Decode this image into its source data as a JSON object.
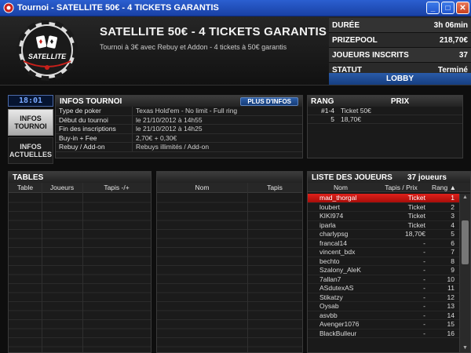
{
  "window": {
    "title": "Tournoi - SATELLITE 50€ - 4 TICKETS GARANTIS"
  },
  "logo": {
    "text": "SATELLITE"
  },
  "header": {
    "title": "SATELLITE 50€ - 4 TICKETS GARANTIS",
    "subtitle": "Tournoi à 3€ avec Rebuy et Addon - 4 tickets à 50€ garantis",
    "stats": [
      {
        "label": "DURÉE",
        "value": "3h 06min"
      },
      {
        "label": "PRIZEPOOL",
        "value": "218,70€"
      },
      {
        "label": "JOUEURS INSCRITS",
        "value": "37"
      },
      {
        "label": "STATUT",
        "value": "Terminé"
      }
    ],
    "lobby_label": "LOBBY"
  },
  "clock": "18:01",
  "tabs": {
    "infos_tournoi": "INFOS TOURNOI",
    "infos_actuelles": "INFOS ACTUELLES"
  },
  "infos": {
    "title": "INFOS TOURNOI",
    "more_button": "PLUS D'INFOS",
    "rows": [
      {
        "k": "Type de poker",
        "v": "Texas Hold'em - No limit - Full ring"
      },
      {
        "k": "Début du tournoi",
        "v": "le 21/10/2012 à 14h55"
      },
      {
        "k": "Fin des inscriptions",
        "v": "le 21/10/2012 à 14h25"
      },
      {
        "k": "Buy-in + Fee",
        "v": "2,70€ + 0,30€"
      },
      {
        "k": "Rebuy / Add-on",
        "v": "Rebuys illimités / Add-on"
      }
    ]
  },
  "prizes": {
    "rang_label": "RANG",
    "prix_label": "PRIX",
    "rows": [
      {
        "rang": "#1-4",
        "prix": "Ticket 50€"
      },
      {
        "rang": "5",
        "prix": "18,70€"
      }
    ]
  },
  "tables": {
    "title": "TABLES",
    "columns": [
      "Table",
      "Joueurs",
      "Tapis -/+"
    ],
    "columns2": [
      "Nom",
      "Tapis"
    ]
  },
  "players": {
    "title": "LISTE DES JOUEURS",
    "count": "37 joueurs",
    "columns": [
      "Nom",
      "Tapis / Prix",
      "Rang ▲"
    ],
    "rows": [
      {
        "name": "mad_thorgal",
        "tapis": "Ticket",
        "rang": "1"
      },
      {
        "name": "loubert",
        "tapis": "Ticket",
        "rang": "2"
      },
      {
        "name": "KIKI974",
        "tapis": "Ticket",
        "rang": "3"
      },
      {
        "name": "iparla",
        "tapis": "Ticket",
        "rang": "4"
      },
      {
        "name": "charlypsg",
        "tapis": "18,70€",
        "rang": "5"
      },
      {
        "name": "francal14",
        "tapis": "-",
        "rang": "6"
      },
      {
        "name": "vincent_bdx",
        "tapis": "-",
        "rang": "7"
      },
      {
        "name": "bechto",
        "tapis": "-",
        "rang": "8"
      },
      {
        "name": "Szalony_AleK",
        "tapis": "-",
        "rang": "9"
      },
      {
        "name": "7allan7",
        "tapis": "-",
        "rang": "10"
      },
      {
        "name": "ASdutexAS",
        "tapis": "-",
        "rang": "11"
      },
      {
        "name": "Stikatzy",
        "tapis": "-",
        "rang": "12"
      },
      {
        "name": "Oysab",
        "tapis": "-",
        "rang": "13"
      },
      {
        "name": "asvbb",
        "tapis": "-",
        "rang": "14"
      },
      {
        "name": "Avenger1076",
        "tapis": "-",
        "rang": "15"
      },
      {
        "name": "BlackBulleur",
        "tapis": "-",
        "rang": "16"
      }
    ]
  }
}
